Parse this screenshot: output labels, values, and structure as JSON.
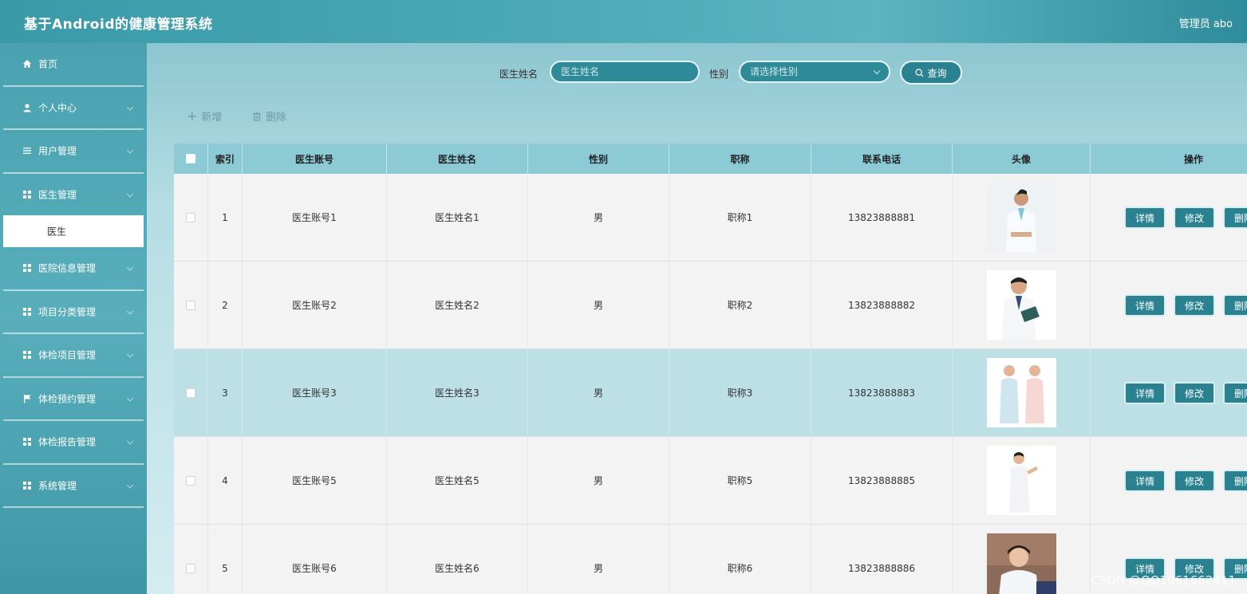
{
  "header": {
    "title": "基于Android的健康管理系统",
    "user": "管理员 abo"
  },
  "sidebar": {
    "items": [
      {
        "label": "首页",
        "icon": "home-icon"
      },
      {
        "label": "个人中心",
        "icon": "user-icon"
      },
      {
        "label": "用户管理",
        "icon": "list-icon"
      },
      {
        "label": "医生管理",
        "icon": "grid-icon"
      },
      {
        "label": "医院信息管理",
        "icon": "grid-icon"
      },
      {
        "label": "项目分类管理",
        "icon": "grid-icon"
      },
      {
        "label": "体检项目管理",
        "icon": "grid-icon"
      },
      {
        "label": "体检预约管理",
        "icon": "flag-icon"
      },
      {
        "label": "体检报告管理",
        "icon": "grid-icon"
      },
      {
        "label": "系统管理",
        "icon": "grid-icon"
      }
    ],
    "submenu": {
      "label": "医生"
    }
  },
  "search": {
    "name_label": "医生姓名",
    "name_placeholder": "医生姓名",
    "gender_label": "性别",
    "gender_placeholder": "请选择性别",
    "query_button": "查询"
  },
  "actions": {
    "add": "新增",
    "delete": "删除"
  },
  "table": {
    "headers": [
      "索引",
      "医生账号",
      "医生姓名",
      "性别",
      "职称",
      "联系电话",
      "头像",
      "操作"
    ],
    "rows": [
      {
        "index": "1",
        "account": "医生账号1",
        "name": "医生姓名1",
        "gender": "男",
        "title": "职称1",
        "phone": "13823888881"
      },
      {
        "index": "2",
        "account": "医生账号2",
        "name": "医生姓名2",
        "gender": "男",
        "title": "职称2",
        "phone": "13823888882"
      },
      {
        "index": "3",
        "account": "医生账号3",
        "name": "医生姓名3",
        "gender": "男",
        "title": "职称3",
        "phone": "13823888883"
      },
      {
        "index": "4",
        "account": "医生账号5",
        "name": "医生姓名5",
        "gender": "男",
        "title": "职称5",
        "phone": "13823888885"
      },
      {
        "index": "5",
        "account": "医生账号6",
        "name": "医生姓名6",
        "gender": "男",
        "title": "职称6",
        "phone": "13823888886"
      }
    ],
    "row_buttons": {
      "detail": "详情",
      "edit": "修改",
      "delete": "删除"
    }
  },
  "watermark": "CSDN @QQ1061662411",
  "colors": {
    "accent": "#2a8291",
    "header_bg": "#8ccad6",
    "highlight_row": "#bde0e6"
  }
}
